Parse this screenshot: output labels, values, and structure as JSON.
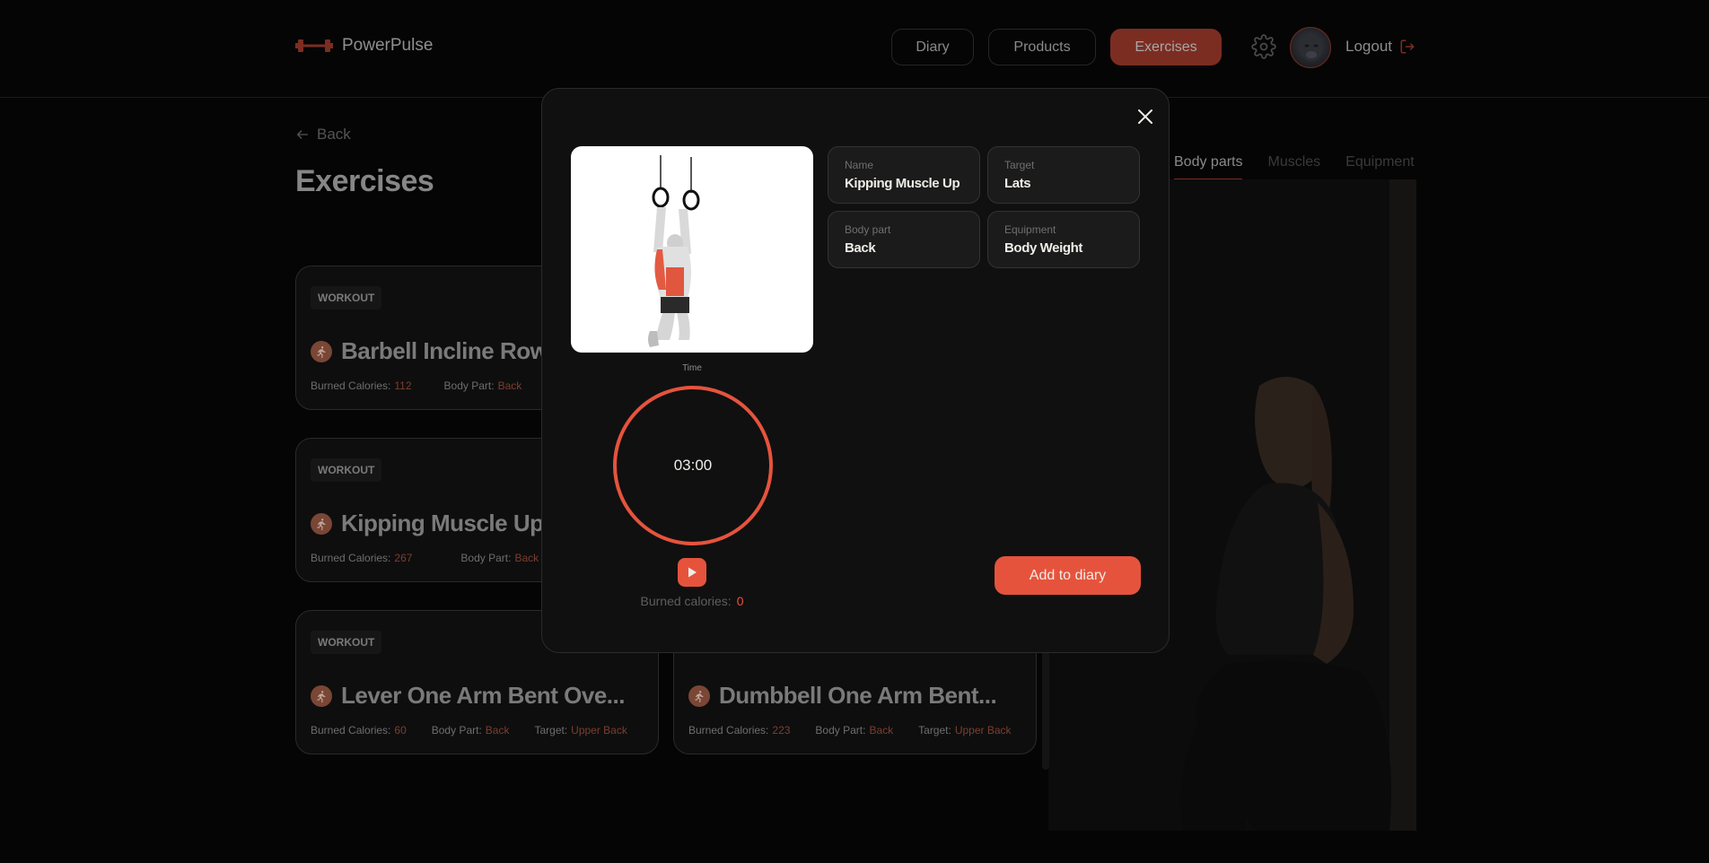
{
  "header": {
    "logo_text": "PowerPulse",
    "nav": [
      {
        "label": "Diary",
        "active": false
      },
      {
        "label": "Products",
        "active": false
      },
      {
        "label": "Exercises",
        "active": true
      }
    ],
    "settings_icon": "gear-icon",
    "logout_label": "Logout",
    "logout_icon": "logout-arrow-icon"
  },
  "page": {
    "back_label": "Back",
    "title": "Exercises",
    "tabs": [
      {
        "label": "Body parts",
        "active": true
      },
      {
        "label": "Muscles",
        "active": false
      },
      {
        "label": "Equipment",
        "active": false
      }
    ]
  },
  "cards": [
    {
      "badge": "WORKOUT",
      "title": "Barbell Incline Row",
      "calories_label": "Burned Calories:",
      "calories": "112",
      "body_part_label": "Body Part:",
      "body_part": "Back"
    },
    {
      "badge": "WORKOUT",
      "title": "Kipping Muscle Up",
      "calories_label": "Burned Calories:",
      "calories": "267",
      "body_part_label": "Body Part:",
      "body_part": "Back"
    },
    {
      "badge": "WORKOUT",
      "title": "Lever One Arm Bent Ove...",
      "calories_label": "Burned Calories:",
      "calories": "60",
      "body_part_label": "Body Part:",
      "body_part": "Back",
      "target_label": "Target:",
      "target": "Upper Back"
    },
    {
      "title": "Dumbbell One Arm Bent...",
      "calories_label": "Burned Calories:",
      "calories": "223",
      "body_part_label": "Body Part:",
      "body_part": "Back",
      "target_label": "Target:",
      "target": "Upper Back"
    }
  ],
  "modal": {
    "info": [
      {
        "label": "Name",
        "value": "Kipping Muscle Up"
      },
      {
        "label": "Target",
        "value": "Lats"
      },
      {
        "label": "Body part",
        "value": "Back"
      },
      {
        "label": "Equipment",
        "value": "Body Weight"
      }
    ],
    "time_label": "Time",
    "timer_value": "03:00",
    "timer_progress": 1.0,
    "burned_label": "Burned calories:",
    "burned_value": "0",
    "add_button": "Add to diary"
  },
  "colors": {
    "accent": "#e6533c",
    "accent_dimmed": "#7c2d22",
    "text_light": "#efede8"
  }
}
